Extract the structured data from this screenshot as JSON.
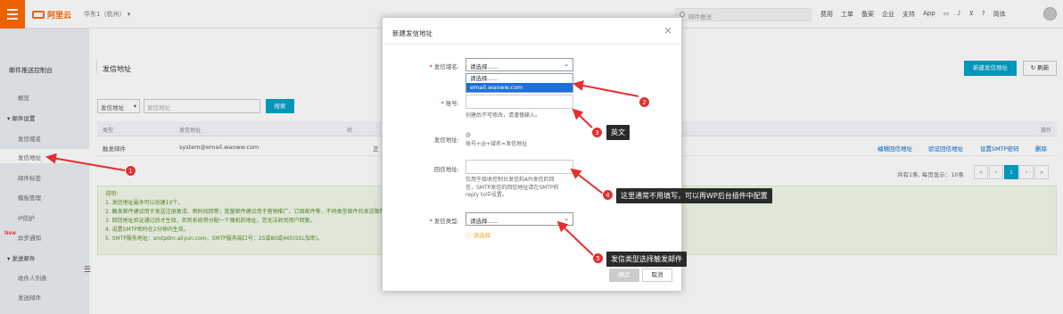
{
  "topbar": {
    "logo_text": "阿里云",
    "region": "华东1（杭州）",
    "search_placeholder": "邮件推送",
    "nav_items": [
      "费用",
      "工单",
      "备案",
      "企业",
      "支持",
      "App"
    ],
    "lang": "简体"
  },
  "sidebar": {
    "title": "邮件推送控制台",
    "items": [
      {
        "label": "概览",
        "type": "item"
      },
      {
        "label": "邮件设置",
        "type": "group"
      },
      {
        "label": "发信域名",
        "type": "item"
      },
      {
        "label": "发信地址",
        "type": "item",
        "active": true
      },
      {
        "label": "邮件标签",
        "type": "item"
      },
      {
        "label": "模板管理",
        "type": "item"
      },
      {
        "label": "IP防护",
        "type": "item"
      },
      {
        "label": "异步通知",
        "type": "item",
        "tag": "New"
      },
      {
        "label": "发送邮件",
        "type": "group"
      },
      {
        "label": "收件人列表",
        "type": "item"
      },
      {
        "label": "发送邮件",
        "type": "item"
      }
    ]
  },
  "page": {
    "title": "发信地址",
    "new_button": "新建发信地址",
    "refresh_button": "刷新",
    "filter_select": "发信地址",
    "filter_placeholder": "发信地址",
    "search_button": "搜索",
    "table_headers": [
      "类型",
      "发信地址",
      "状",
      "操作"
    ],
    "rows": [
      {
        "type": "触发邮件",
        "address": "system@email.waoww.com",
        "status": "正",
        "actions": [
          "编辑回信地址",
          "验证回信地址",
          "设置SMTP密码",
          "删除"
        ]
      }
    ],
    "pager_text": "共有1条, 每页显示：10条",
    "pager_buttons": [
      "«",
      "‹",
      "1",
      "›",
      "»"
    ],
    "notes": [
      "说明：",
      "1. 发信地址最多可以创建10个。",
      "2. 触发邮件建议用于发送注册激活、密码找回等；批量邮件建议用于营销推广、订阅邮件等，不同类型邮件的发送限制不同，",
      "3. 回信地址验证通过后才生效，否则系统将分配一个随机的地址，您无法收到用户回复。",
      "4. 设置SMTP密码在2分钟内生效。",
      "5. SMTP服务地址：smtpdm.aliyun.com，SMTP服务端口号：25或80或465(SSL加密)。"
    ]
  },
  "modal": {
    "title": "新建发信地址",
    "close": "×",
    "domain_label": "发信域名:",
    "domain_value": "请选择......",
    "domain_options": [
      "请选择......",
      "email.waoww.com"
    ],
    "account_label": "账号:",
    "account_help": "创建后不可修改，请谨慎输入。",
    "address_label": "发信地址:",
    "address_at": "@",
    "address_help": "账号+@+域名=发信地址",
    "reply_label": "回信地址:",
    "reply_help": [
      "仅用于接收控制台发信和API发信的回",
      "信，SMTP发信的回信地址请在SMTP的",
      "reply to中设置。"
    ],
    "type_label": "发信类型:",
    "type_value": "请选择......",
    "type_warning": "请选择",
    "ok_button": "确定",
    "cancel_button": "取消"
  },
  "annotations": {
    "badges": [
      "1",
      "2",
      "3",
      "4",
      "5"
    ],
    "callouts": {
      "c3": "英文",
      "c4": "这里通常不用填写，可以再WP后台插件中配置",
      "c5": "发信类型选择触发邮件"
    },
    "colors": {
      "badge": "#e52e2e",
      "arrow": "#e52e2e",
      "accent": "#00a2ca",
      "brand": "#ff6a00"
    }
  }
}
